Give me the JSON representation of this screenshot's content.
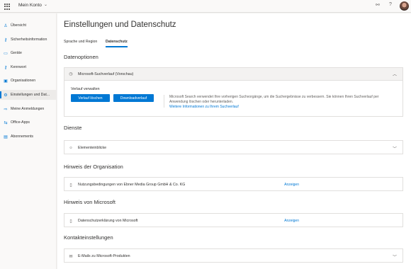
{
  "topbar": {
    "app_title": "Mein Konto"
  },
  "sidebar": {
    "items": [
      {
        "label": "Übersicht",
        "icon": "person-icon",
        "glyph": "♙"
      },
      {
        "label": "Sicherheitsinformation",
        "icon": "key-person-icon",
        "glyph": "⚷"
      },
      {
        "label": "Geräte",
        "icon": "laptop-icon",
        "glyph": "▭"
      },
      {
        "label": "Kennwort",
        "icon": "key-icon",
        "glyph": "⚷"
      },
      {
        "label": "Organisationen",
        "icon": "briefcase-icon",
        "glyph": "▣"
      },
      {
        "label": "Einstellungen und Dat...",
        "icon": "lock-icon",
        "glyph": "⚙",
        "active": true
      },
      {
        "label": "Meine Anmeldungen",
        "icon": "signin-icon",
        "glyph": "⇨"
      },
      {
        "label": "Office-Apps",
        "icon": "office-icon",
        "glyph": "⇆"
      },
      {
        "label": "Abonnements",
        "icon": "card-icon",
        "glyph": "▤"
      }
    ]
  },
  "main": {
    "title": "Einstellungen und Datenschutz",
    "tabs": [
      {
        "label": "Sprache und Region"
      },
      {
        "label": "Datenschutz",
        "active": true
      }
    ],
    "data_options": {
      "heading": "Datenoptionen",
      "card_title": "Microsoft-Suchverlauf (Vorschau)",
      "manage_label": "Verlauf verwalten",
      "clear_button": "Verlauf löschen",
      "download_button": "Downloadverlauf",
      "description": "Microsoft Search verwendet Ihre vorherigen Suchvorgänge, um die Suchergebnisse zu verbessern. Sie können Ihren Suchverlauf per Anwendung löschen oder herunterladen.",
      "more_link": "Weitere Informationen zu Ihrem Suchverlauf"
    },
    "services": {
      "heading": "Dienste",
      "card_title": "Elementeinblicke"
    },
    "org_notice": {
      "heading": "Hinweis der Organisation",
      "card_title": "Nutzungsbedingungen von Ebner Media Group GmbH & Co. KG",
      "link": "Anzeigen"
    },
    "ms_notice": {
      "heading": "Hinweis von Microsoft",
      "card_title": "Datenschutzerklärung von Microsoft",
      "link": "Anzeigen"
    },
    "contact": {
      "heading": "Kontakteinstellungen",
      "card_title": "E-Mails zu Microsoft-Produkten"
    }
  }
}
